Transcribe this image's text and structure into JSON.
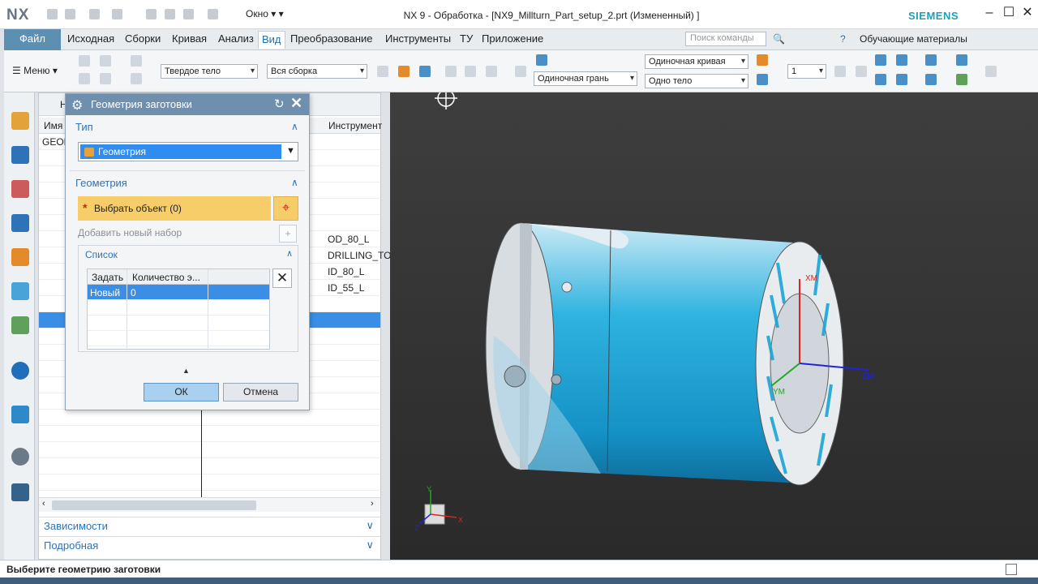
{
  "titlebar": {
    "logo": "NX",
    "window_menu": "Окно",
    "title": "NX 9 - Обработка - [NX9_Millturn_Part_setup_2.prt (Измененный) ]",
    "brand": "SIEMENS"
  },
  "menubar": {
    "file": "Файл",
    "items": [
      "Исходная",
      "Сборки",
      "Кривая",
      "Анализ",
      "Вид",
      "Преобразование",
      "Инструменты",
      "ТУ",
      "Приложение"
    ],
    "search_placeholder": "Поиск команды",
    "tutorials": "Обучающие материалы"
  },
  "ribbon": {
    "menu_label": "Меню",
    "filter_type": "Твердое тело",
    "filter_scope": "Вся сборка",
    "curve_rule": "Одиночная кривая",
    "face_rule": "Одиночная грань",
    "body_rule": "Одно тело",
    "layer_value": "1"
  },
  "navigator": {
    "header_short": "Н",
    "col_name": "Имя",
    "col_tool": "Инструмент",
    "first_row": "GEOM",
    "tools": [
      "OD_80_L",
      "DRILLING_TO",
      "ID_80_L",
      "ID_55_L"
    ],
    "section_dependencies": "Зависимости",
    "section_details": "Подробная"
  },
  "dialog": {
    "title": "Геометрия заготовки",
    "group_type": "Тип",
    "type_value": "Геометрия",
    "group_geometry": "Геометрия",
    "select_object": "Выбрать объект (0)",
    "add_new_set": "Добавить новый набор",
    "list_title": "Список",
    "list_headers": [
      "Задать",
      "Количество э..."
    ],
    "list_rows": [
      {
        "set": "Новый",
        "count": "0"
      }
    ],
    "ok": "ОК",
    "cancel": "Отмена"
  },
  "viewport": {
    "axis_xm": "XM",
    "axis_ym": "YM",
    "axis_zm": "ZM",
    "triad_x": "X",
    "triad_y": "Y",
    "triad_z": "Z"
  },
  "status": {
    "message": "Выберите геометрию заготовки"
  },
  "colors": {
    "accent": "#2e73b8",
    "selection": "#3a8ee6",
    "highlight": "#f7cd6a",
    "part_cyan": "#1aa6d6",
    "viewport_bg": "#333333"
  }
}
